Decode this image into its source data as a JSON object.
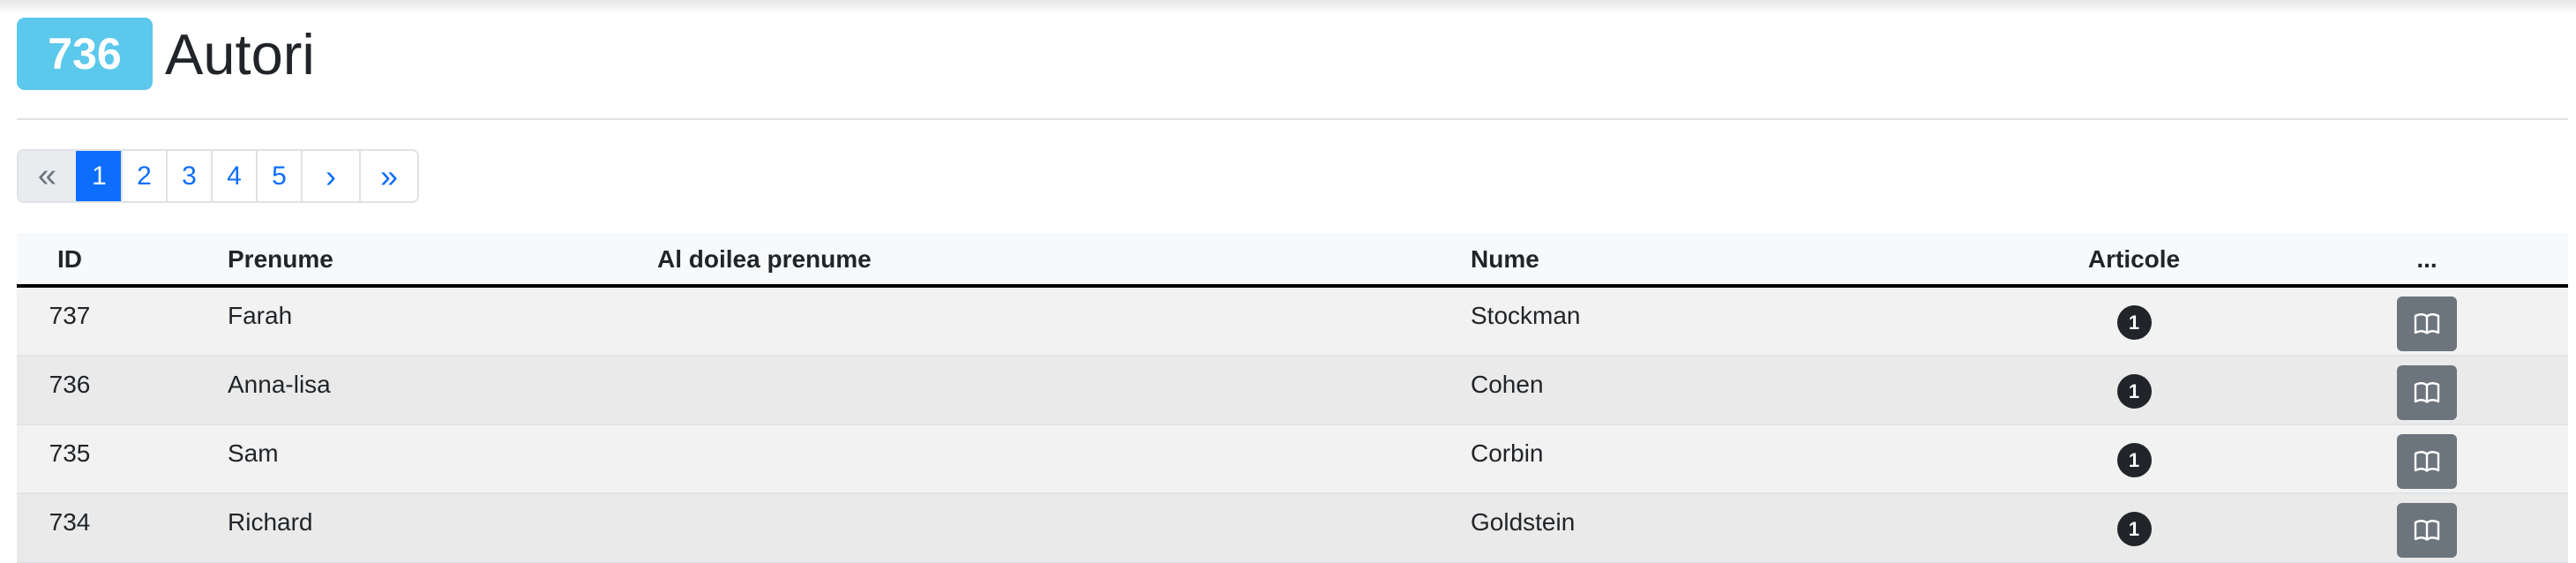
{
  "header": {
    "count": "736",
    "title": "Autori"
  },
  "pagination": {
    "first": "«",
    "pages": [
      "1",
      "2",
      "3",
      "4",
      "5"
    ],
    "active": "1",
    "next": "›",
    "last": "»"
  },
  "table": {
    "columns": {
      "id": "ID",
      "prenume": "Prenume",
      "al_doilea_prenume": "Al doilea prenume",
      "nume": "Nume",
      "articole": "Articole",
      "actions": "..."
    },
    "rows": [
      {
        "id": "737",
        "prenume": "Farah",
        "al_doilea_prenume": "",
        "nume": "Stockman",
        "articole": "1"
      },
      {
        "id": "736",
        "prenume": "Anna-lisa",
        "al_doilea_prenume": "",
        "nume": "Cohen",
        "articole": "1"
      },
      {
        "id": "735",
        "prenume": "Sam",
        "al_doilea_prenume": "",
        "nume": "Corbin",
        "articole": "1"
      },
      {
        "id": "734",
        "prenume": "Richard",
        "al_doilea_prenume": "",
        "nume": "Goldstein",
        "articole": "1"
      }
    ],
    "row_action_icon": "book-open-icon"
  },
  "colors": {
    "count_badge": "#5bc8ec",
    "active_page": "#0d6efd",
    "link": "#0d6efd",
    "action_button": "#6c757d",
    "pill": "#212529"
  }
}
